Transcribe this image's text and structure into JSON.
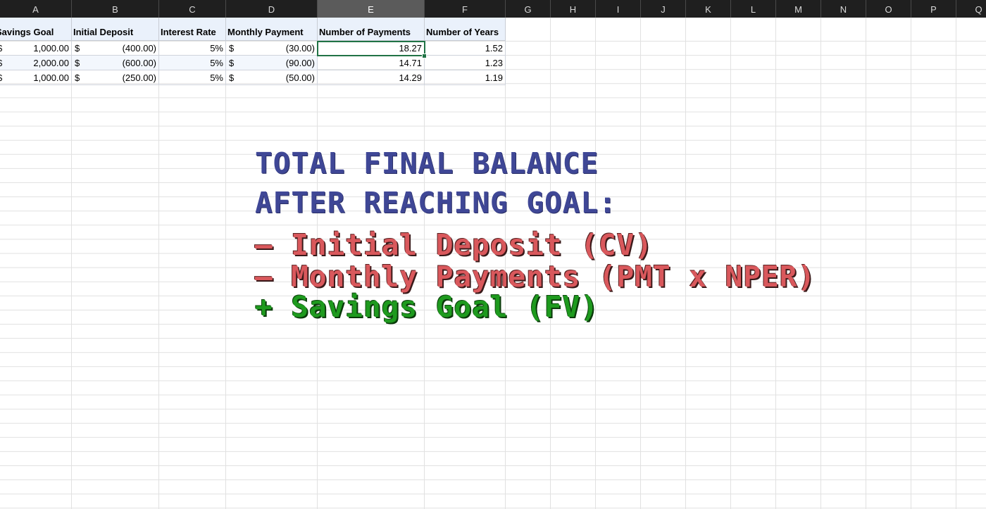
{
  "columns": [
    "A",
    "B",
    "C",
    "D",
    "E",
    "F",
    "G",
    "H",
    "I",
    "J",
    "K",
    "L",
    "M",
    "N",
    "O",
    "P",
    "Q"
  ],
  "selected_column": "E",
  "headers": {
    "A": "Savings Goal",
    "B": "Initial Deposit",
    "C": "Interest Rate",
    "D": "Monthly Payment",
    "E": "Number of Payments",
    "F": "Number of Years"
  },
  "currency_symbol": "$",
  "rows": [
    {
      "savings_goal": "1,000.00",
      "initial_deposit": "(400.00)",
      "interest_rate": "5%",
      "monthly_payment": "(30.00)",
      "num_payments": "18.27",
      "num_years": "1.52"
    },
    {
      "savings_goal": "2,000.00",
      "initial_deposit": "(600.00)",
      "interest_rate": "5%",
      "monthly_payment": "(90.00)",
      "num_payments": "14.71",
      "num_years": "1.23"
    },
    {
      "savings_goal": "1,000.00",
      "initial_deposit": "(250.00)",
      "interest_rate": "5%",
      "monthly_payment": "(50.00)",
      "num_payments": "14.29",
      "num_years": "1.19"
    }
  ],
  "overlay": {
    "line1": "TOTAL FINAL BALANCE",
    "line2": "AFTER REACHING GOAL:",
    "line3": "– Initial Deposit (CV)",
    "line4": "– Monthly Payments (PMT x NPER)",
    "line5": "+ Savings Goal (FV)",
    "colors": {
      "heading": "#3f4796",
      "minus": "#d9585c",
      "plus": "#1e9a1e"
    }
  },
  "colors": {
    "header_bar": "#1f1f1f",
    "selected_header": "#5b5b5b",
    "active_cell_border": "#217346",
    "table_header_fill": "#eaf1fb"
  }
}
